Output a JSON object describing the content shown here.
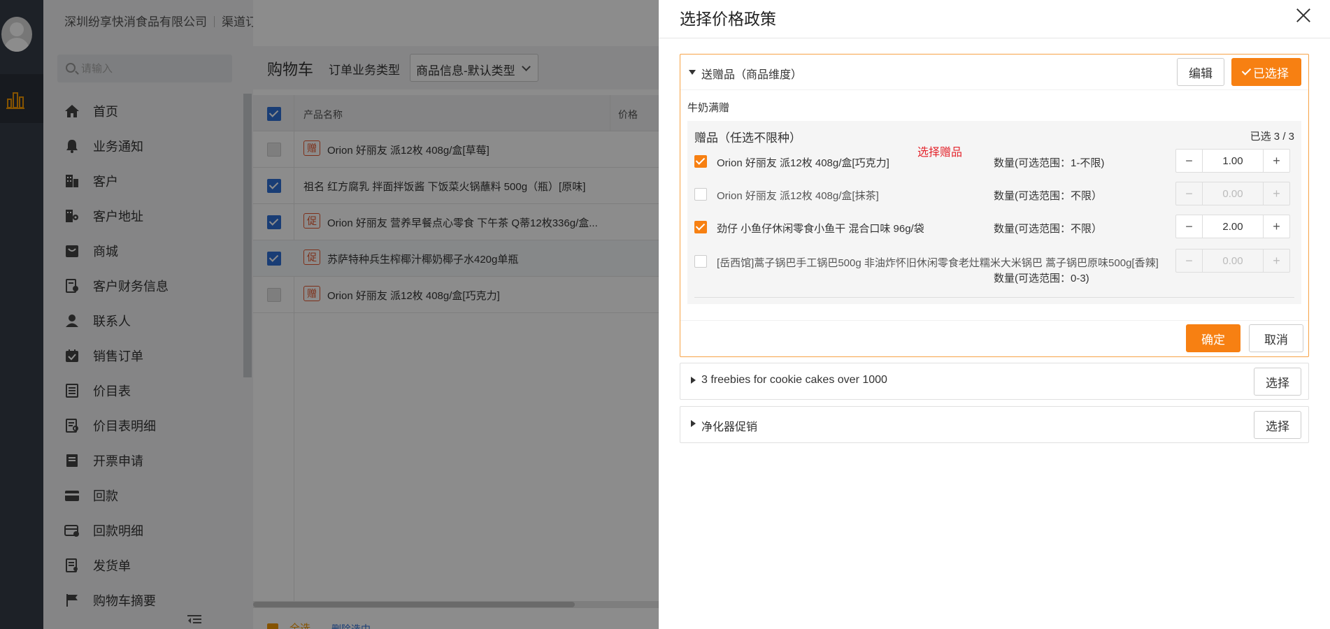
{
  "sidebar": {
    "company": "深圳纷享快消食品有限公司",
    "channel": "渠道订货（预设）",
    "search_placeholder": "请输入",
    "items": [
      {
        "label": "首页",
        "icon": "home-icon"
      },
      {
        "label": "业务通知",
        "icon": "bell-icon"
      },
      {
        "label": "客户",
        "icon": "building-icon"
      },
      {
        "label": "客户地址",
        "icon": "address-icon"
      },
      {
        "label": "商城",
        "icon": "shop-icon"
      },
      {
        "label": "客户财务信息",
        "icon": "finance-icon"
      },
      {
        "label": "联系人",
        "icon": "contact-icon"
      },
      {
        "label": "销售订单",
        "icon": "order-icon"
      },
      {
        "label": "价目表",
        "icon": "pricelist-icon"
      },
      {
        "label": "价目表明细",
        "icon": "pricelist-detail-icon"
      },
      {
        "label": "开票申请",
        "icon": "invoice-icon"
      },
      {
        "label": "回款",
        "icon": "payment-icon"
      },
      {
        "label": "回款明细",
        "icon": "payment-detail-icon"
      },
      {
        "label": "发货单",
        "icon": "delivery-icon"
      },
      {
        "label": "购物车摘要",
        "icon": "flag-icon"
      }
    ]
  },
  "cart": {
    "title": "购物车",
    "order_type_label": "订单业务类型",
    "order_type_value": "商品信息-默认类型",
    "columns": {
      "name": "产品名称",
      "price": "价格"
    },
    "rows": [
      {
        "checked": "disabled",
        "tag": "赠",
        "name": "Orion 好丽友 派12枚 408g/盒[草莓]"
      },
      {
        "checked": "on",
        "tag": "",
        "name": "祖名 红方腐乳 拌面拌饭酱 下饭菜火锅蘸料 500g（瓶）[原味]"
      },
      {
        "checked": "on",
        "tag": "促",
        "name": "Orion 好丽友 营养早餐点心零食 下午茶 Q蒂12枚336g/盒..."
      },
      {
        "checked": "on",
        "tag": "促",
        "name": "苏萨特种兵生榨椰汁椰奶椰子水420g单瓶"
      },
      {
        "checked": "disabled",
        "tag": "赠",
        "name": "Orion 好丽友 派12枚 408g/盒[巧克力]"
      }
    ],
    "footer": {
      "select_all": "全选",
      "delete_selected": "删除选中"
    }
  },
  "drawer": {
    "title": "选择价格政策",
    "policies": [
      {
        "name": "送赠品（商品维度）",
        "edit_label": "编辑",
        "selected_label": "已选择",
        "sub_title": "牛奶满赠",
        "gift_title": "赠品（任选不限种）",
        "gift_count": "已选 3 / 3",
        "hint": "选择赠品",
        "gifts": [
          {
            "checked": true,
            "name": "Orion 好丽友 派12枚 408g/盒[巧克力]",
            "qty_label": "数量(可选范围：1-不限)",
            "value": "1.00",
            "disabled": false
          },
          {
            "checked": false,
            "name": "Orion 好丽友 派12枚 408g/盒[抹茶]",
            "qty_label": "数量(可选范围：不限）",
            "value": "0.00",
            "disabled": true
          },
          {
            "checked": true,
            "name": "劲仔 小鱼仔休闲零食小鱼干 混合口味 96g/袋",
            "qty_label": "数量(可选范围：不限）",
            "value": "2.00",
            "disabled": false
          },
          {
            "checked": false,
            "name": "[岳西馆]蒿子锅巴手工锅巴500g 非油炸怀旧休闲零食老灶糯米大米锅巴 蒿子锅巴原味500g[香辣]",
            "qty_label": "数量(可选范围：0-3)",
            "value": "0.00",
            "disabled": true
          }
        ],
        "confirm_label": "确定",
        "cancel_label": "取消"
      },
      {
        "name": "3 freebies for cookie cakes over 1000",
        "select_label": "选择"
      },
      {
        "name": "净化器促销",
        "select_label": "选择"
      }
    ]
  },
  "colors": {
    "accent": "#f78012",
    "primary_blue": "#2f6fd6",
    "danger": "#e4262e"
  }
}
